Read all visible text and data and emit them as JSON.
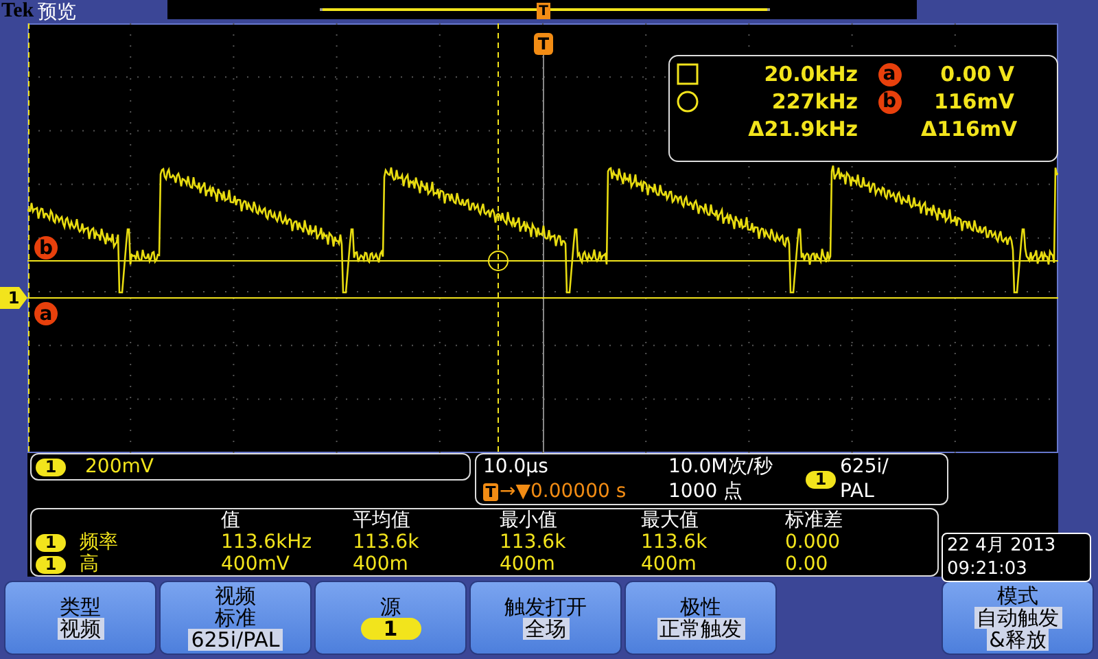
{
  "header": {
    "logo": "Tek",
    "mode": "预览",
    "trigger_marker": "T"
  },
  "screen_markers": {
    "trigger": "T",
    "channel": "1",
    "cursor_b": "b",
    "cursor_a": "a"
  },
  "cursor_readout": {
    "rows": [
      {
        "kind": "square",
        "freq": "20.0kHz",
        "marker": "a",
        "value": "0.00 V"
      },
      {
        "kind": "circle",
        "freq": "227kHz",
        "marker": "b",
        "value": "116mV"
      }
    ],
    "delta_freq": "Δ21.9kHz",
    "delta_value": "Δ116mV"
  },
  "vertical": {
    "channel": "1",
    "scale": "200mV"
  },
  "horizontal": {
    "timebase": "10.0µs",
    "trigger_marker": "T",
    "trigger_position": "→▼0.00000 s",
    "sample_rate": "10.0M次/秒",
    "record_length": "1000 点",
    "trigger_channel": "1",
    "trigger_standard_lines": [
      "625i/",
      "PAL"
    ]
  },
  "measurements": {
    "columns": [
      "值",
      "平均值",
      "最小值",
      "最大值",
      "标准差"
    ],
    "rows": [
      {
        "channel": "1",
        "name": "频率",
        "values": [
          "113.6kHz",
          "113.6k",
          "113.6k",
          "113.6k",
          "0.000"
        ]
      },
      {
        "channel": "1",
        "name": "高",
        "values": [
          "400mV",
          "400m",
          "400m",
          "400m",
          "0.00"
        ]
      }
    ]
  },
  "datetime": {
    "date": "22 4月 2013",
    "time": "09:21:03"
  },
  "menu_buttons": [
    {
      "kind": "text",
      "title_lines": [
        "类型"
      ],
      "value_lines": [
        "视频"
      ]
    },
    {
      "kind": "text",
      "title_lines": [
        "视频",
        "标准"
      ],
      "value_lines": [
        "625i/PAL"
      ]
    },
    {
      "kind": "badge",
      "title_lines": [
        "源"
      ],
      "value_lines": [
        "1"
      ]
    },
    {
      "kind": "text",
      "title_lines": [
        "触发打开"
      ],
      "value_lines": [
        "全场"
      ]
    },
    {
      "kind": "text",
      "title_lines": [
        "极性"
      ],
      "value_lines": [
        "正常触发"
      ]
    },
    {
      "kind": "text",
      "title_lines": [
        "模式"
      ],
      "value_lines": [
        "自动触发",
        "&释放"
      ]
    }
  ]
}
